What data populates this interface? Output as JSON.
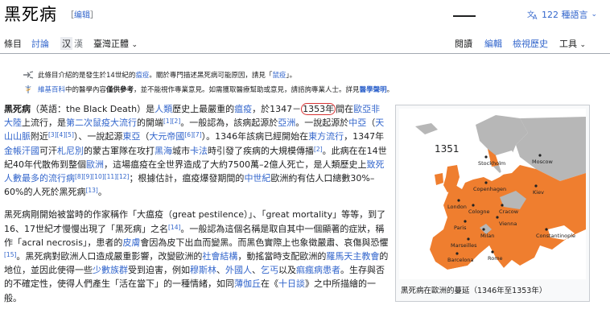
{
  "header": {
    "title": "黑死病",
    "edit_bracket_open": "［",
    "edit_label": "编辑",
    "edit_bracket_close": "］",
    "lang_label": "122 種語言"
  },
  "tabs": {
    "article": "條目",
    "talk": "討論",
    "variant_1": "汉",
    "variant_2": "漢",
    "regional": "臺灣正體",
    "read": "閱讀",
    "edit": "編輯",
    "history": "檢視歷史",
    "tools": "工具"
  },
  "hatnotes": {
    "h1_a": "此條目介紹的是發生於14世紀的",
    "h1_link1": "瘟疫",
    "h1_b": "。關於專門描述黑死病可能原因，請見「",
    "h1_link2": "鼠疫",
    "h1_c": "」。",
    "h2_link1": "維基百科",
    "h2_a": "中的醫學內容",
    "h2_bold": "僅供參考",
    "h2_b": "，並不能視作專業意見。如需獲取醫療幫助或意見，請諮詢專業人士。詳見",
    "h2_link2": "醫學聲明",
    "h2_c": "。"
  },
  "p1": {
    "t1": "黑死病",
    "t2": "（英語：the Black Death）是",
    "l1": "人類",
    "t3": "歷史上最嚴重的",
    "l2": "瘟疫",
    "t4": "，於1347－",
    "t5": "1353年",
    "t6": "間在",
    "l3": "歐亞非大陸",
    "t7": "上流行，是",
    "l4": "第二次鼠疫大流行",
    "t8": "的開端",
    "s1": "[1][2]",
    "t9": "。一般認為，該病起源於",
    "l5": "亞洲",
    "t10": "。一說起源於",
    "l6": "中亞",
    "t11": "（",
    "l7": "天山山脈",
    "t12": "附近",
    "s2": "[3][4][5]",
    "t13": "）、一說起源",
    "l8": "東亞",
    "t14": "（",
    "l9": "大元帝國",
    "s3": "[6][7]",
    "t15": "）。1346年該病已經開始在",
    "l10": "東方流行",
    "t16": "，1347年",
    "l11": "金帳汗國",
    "t17": "可汗",
    "l12": "札尼別",
    "t18": "的蒙古軍隊在攻打",
    "l13": "黑海",
    "t19": "城市",
    "l14": "卡法",
    "t20": "時引發了疾病的大規模傳播",
    "s4": "[2]",
    "t21": "。此病在在14世紀40年代散佈到整個",
    "l15": "歐洲",
    "t22": "，這場瘟疫在全世界造成了大約7500萬–2億人死亡，是人類歷史上",
    "l16": "致死人數最多的流行病",
    "s5": "[8][9][10][11][12]",
    "t23": "；根據估計，瘟疫爆發期間的",
    "l17": "中世紀",
    "t24": "歐洲約有估人口總數30%–60%的人死於黑死病",
    "s6": "[13]",
    "t25": "。"
  },
  "p2": {
    "t1": "黑死病剛開始被當時的作家稱作「大瘟疫（great pestilence）」、「great mortality」等等，到了16、17世紀才慢慢出現了「黑死病」之名",
    "s1": "[14]",
    "t2": "。一般認為這個名稱是取自其中一個顯著的症狀，稱作「acral necrosis」，患者的",
    "l1": "皮膚",
    "t3": "會因為皮下出血而變黑。而黑色實際上也象徵嚴肅、哀傷與恐懼",
    "s2": "[15]",
    "t4": "。黑死病對歐洲人口造成嚴重影響，改變歐洲的",
    "l2": "社會結構",
    "t5": "，動搖當時支配歐洲的",
    "l3": "羅馬天主教會",
    "t6": "的地位，並因此使得一些",
    "l4": "少數族群",
    "t7": "受到迫害，例如",
    "l5": "穆斯林",
    "t8": "、",
    "l6": "外國人",
    "t9": "、",
    "l7": "乞丐",
    "t10": "以及",
    "l8": "痲瘋病患者",
    "t11": "。生存與否的不確定性，使得人們產生「活在當下」的一種情緒，如同",
    "l9": "薄伽丘",
    "t12": "在《",
    "l10": "十日談",
    "t13": "》之中所描繪的一般。"
  },
  "infobox": {
    "map_year": "1351",
    "cities": [
      "Stockholm",
      "Moscow",
      "Copenhagen",
      "Kiev",
      "London",
      "Cologne",
      "Cracow",
      "Paris",
      "Vienna",
      "Milan",
      "Marseilles",
      "Constantinople",
      "Barcelona",
      "Rome"
    ],
    "caption": "黑死病在歐洲的蔓延（1346年至1353年）"
  }
}
